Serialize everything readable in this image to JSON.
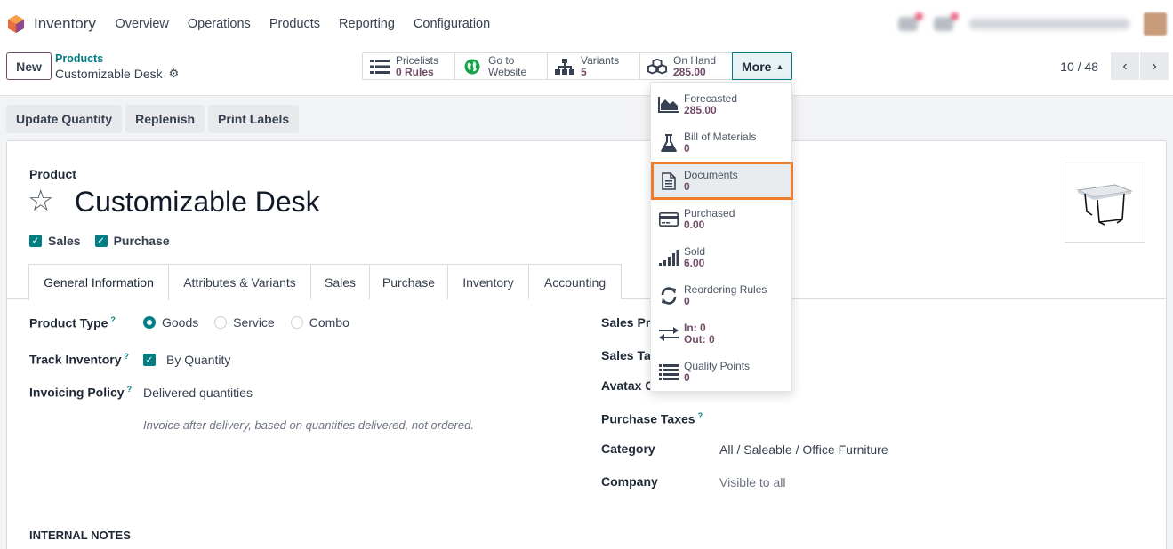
{
  "navbar": {
    "app_name": "Inventory",
    "menu": [
      "Overview",
      "Operations",
      "Products",
      "Reporting",
      "Configuration"
    ]
  },
  "control": {
    "new_label": "New",
    "breadcrumb_parent": "Products",
    "breadcrumb_current": "Customizable Desk",
    "pager": "10 / 48"
  },
  "smart_buttons": [
    {
      "label": "Pricelists",
      "value": "0 Rules",
      "icon": "list-icon"
    },
    {
      "label": "Go to",
      "value": "Website",
      "icon": "globe-icon"
    },
    {
      "label": "Variants",
      "value": "5",
      "icon": "sitemap-icon"
    },
    {
      "label": "On Hand",
      "value": "285.00",
      "icon": "cubes-icon"
    }
  ],
  "more_label": "More",
  "more_menu": [
    {
      "label": "Forecasted",
      "value": "285.00",
      "icon": "area-chart-icon"
    },
    {
      "label": "Bill of Materials",
      "value": "0",
      "icon": "flask-icon"
    },
    {
      "label": "Documents",
      "value": "0",
      "icon": "file-text-icon"
    },
    {
      "label": "Purchased",
      "value": "0.00",
      "icon": "credit-card-icon"
    },
    {
      "label": "Sold",
      "value": "6.00",
      "icon": "signal-icon"
    },
    {
      "label": "Reordering Rules",
      "value": "0",
      "icon": "refresh-icon"
    },
    {
      "label": "In: 0",
      "value": "Out: 0",
      "icon": "exchange-icon"
    },
    {
      "label": "Quality Points",
      "value": "0",
      "icon": "list-icon"
    }
  ],
  "actions": [
    "Update Quantity",
    "Replenish",
    "Print Labels"
  ],
  "form": {
    "product_label": "Product",
    "name": "Customizable Desk",
    "sales_label": "Sales",
    "purchase_label": "Purchase",
    "tabs": [
      "General Information",
      "Attributes & Variants",
      "Sales",
      "Purchase",
      "Inventory",
      "Accounting"
    ],
    "product_type": {
      "label": "Product Type",
      "options": [
        "Goods",
        "Service",
        "Combo"
      ],
      "selected": "Goods"
    },
    "track_inventory": {
      "label": "Track Inventory",
      "value": "By Quantity"
    },
    "invoicing_policy": {
      "label": "Invoicing Policy",
      "value": "Delivered quantities",
      "hint": "Invoice after delivery, based on quantities delivered, not ordered."
    },
    "sales_price_label": "Sales Pric",
    "sales_taxes_label": "Sales Tax",
    "avatax_label": "Avatax C",
    "purchase_taxes_label": "Purchase Taxes",
    "category": {
      "label": "Category",
      "value": "All / Saleable / Office Furniture"
    },
    "company": {
      "label": "Company",
      "value": "Visible to all"
    },
    "internal_notes": "INTERNAL NOTES",
    "help_mark": "?"
  },
  "colors": {
    "primary": "#714b67",
    "accent": "#017e84",
    "highlight": "#f07c2b"
  }
}
